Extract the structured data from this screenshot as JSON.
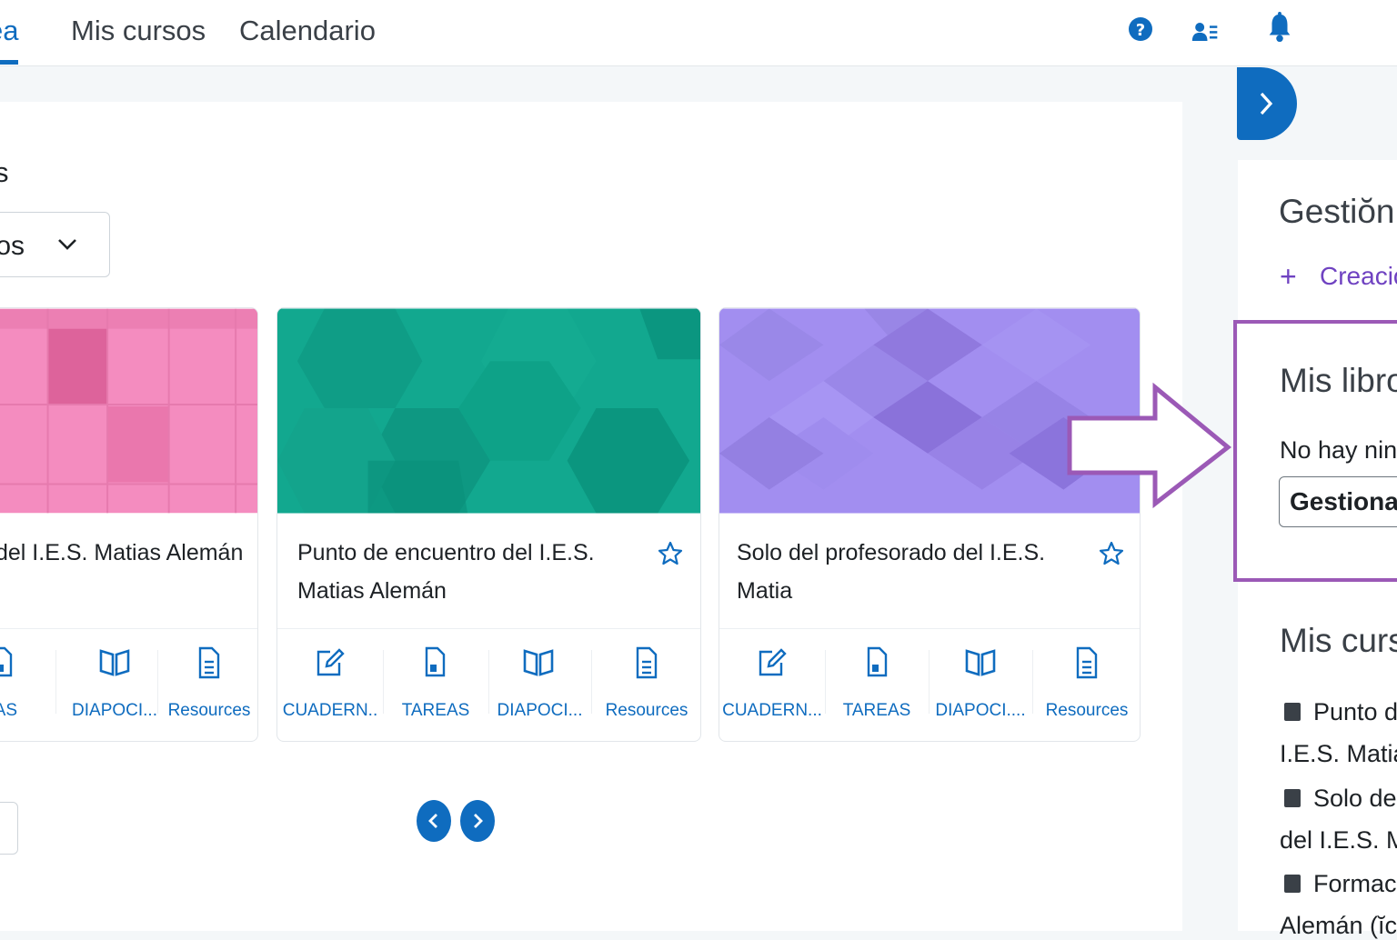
{
  "nav": {
    "active_label": "ea",
    "items": [
      "Mis cursos",
      "Calendario"
    ],
    "icons": [
      "help-icon",
      "contacts-icon",
      "notifications-icon"
    ]
  },
  "courses_section": {
    "heading": "s",
    "filter_value": "tos",
    "cards": [
      {
        "title": "del I.E.S. Matias Alemán",
        "color": "#f189bb",
        "activities": [
          {
            "label": "EAS",
            "icon": "file-icon"
          },
          {
            "label": "DIAPOCI...",
            "icon": "book-icon"
          },
          {
            "label": "Resources",
            "icon": "document-icon"
          }
        ]
      },
      {
        "title": "Punto de encuentro del I.E.S. Matias Alemán",
        "color": "#11a88e",
        "activities": [
          {
            "label": "CUADERN..",
            "icon": "edit-icon"
          },
          {
            "label": "TAREAS",
            "icon": "file-icon"
          },
          {
            "label": "DIAPOCI...",
            "icon": "book-icon"
          },
          {
            "label": "Resources",
            "icon": "document-icon"
          }
        ]
      },
      {
        "title": "Solo del profesorado del I.E.S. Matia",
        "color": "#9f8ce8",
        "activities": [
          {
            "label": "CUADERN...",
            "icon": "edit-icon"
          },
          {
            "label": "TAREAS",
            "icon": "file-icon"
          },
          {
            "label": "DIAPOCI....",
            "icon": "book-icon"
          },
          {
            "label": "Resources",
            "icon": "document-icon"
          }
        ]
      }
    ]
  },
  "drawer": {
    "gestion_title": "Gestiŏn",
    "create_link": "Creació",
    "books_title": "Mis libro",
    "no_books": "No hay ning",
    "manage_button": "Gestionar",
    "my_courses_title": "Mis curs",
    "course_lines": [
      "Punto d",
      "I.E.S. Matias",
      "Solo del",
      "del I.E.S. Ma",
      "Formac",
      "Alemán (ĭc"
    ]
  },
  "colors": {
    "accent": "#0f6cbf",
    "highlight": "#9b59b6"
  }
}
